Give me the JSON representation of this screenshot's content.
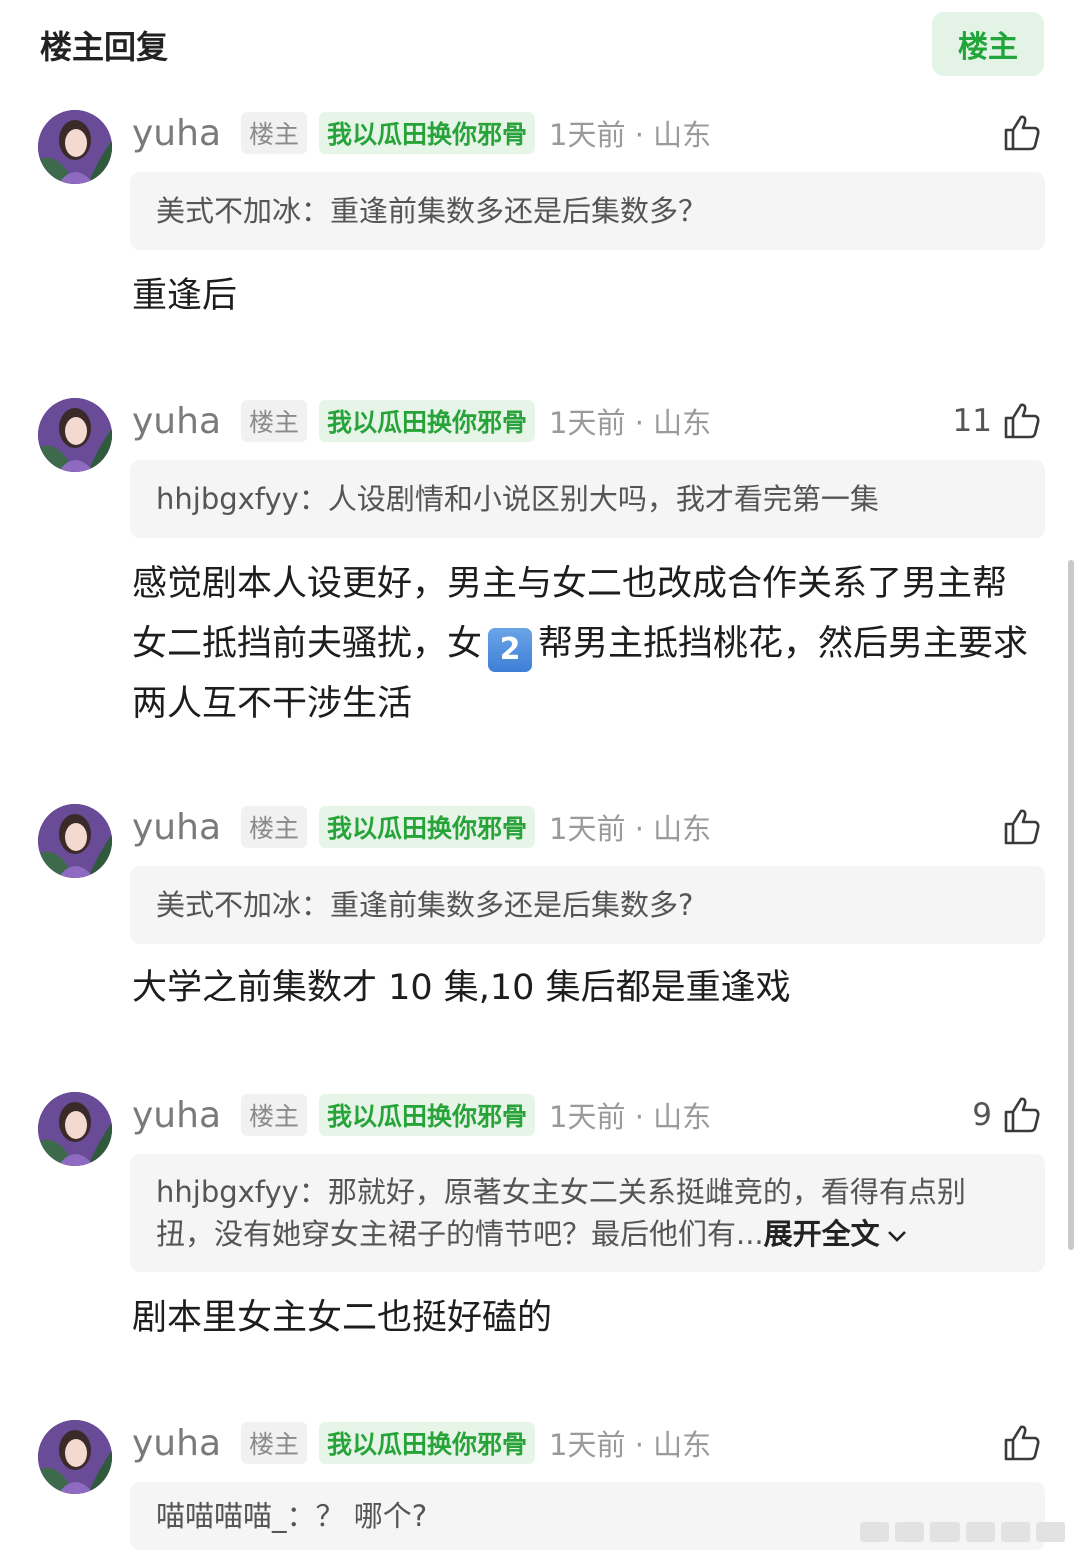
{
  "header": {
    "title": "楼主回复",
    "filter_button": "楼主"
  },
  "comments": [
    {
      "username": "yuha",
      "op_tag": "楼主",
      "fan_tag": "我以瓜田换你邪骨",
      "meta": "1天前 · 山东",
      "likes": "",
      "quote_author": "美式不加冰：",
      "quote_text": "重逢前集数多还是后集数多？",
      "reply": "重逢后"
    },
    {
      "username": "yuha",
      "op_tag": "楼主",
      "fan_tag": "我以瓜田换你邪骨",
      "meta": "1天前 · 山东",
      "likes": "11",
      "quote_author": "hhjbgxfyy：",
      "quote_text": "人设剧情和小说区别大吗，我才看完第一集",
      "reply_part1": "感觉剧本人设更好，男主与女二也改成合作关系了男主帮女二抵挡前夫骚扰，女",
      "reply_badge": "2",
      "reply_part2": "帮男主抵挡桃花，然后男主要求两人互不干涉生活"
    },
    {
      "username": "yuha",
      "op_tag": "楼主",
      "fan_tag": "我以瓜田换你邪骨",
      "meta": "1天前 · 山东",
      "likes": "",
      "quote_author": "美式不加冰：",
      "quote_text": "重逢前集数多还是后集数多?",
      "reply": "大学之前集数才 10 集,10 集后都是重逢戏"
    },
    {
      "username": "yuha",
      "op_tag": "楼主",
      "fan_tag": "我以瓜田换你邪骨",
      "meta": "1天前 · 山东",
      "likes": "9",
      "quote_author": "hhjbgxfyy：",
      "quote_text": "那就好，原著女主女二关系挺雌竞的，看得有点别扭，没有她穿女主裙子的情节吧？最后他们有...",
      "expand_label": "展开全文",
      "reply": "剧本里女主女二也挺好磕的"
    },
    {
      "username": "yuha",
      "op_tag": "楼主",
      "fan_tag": "我以瓜田换你邪骨",
      "meta": "1天前 · 山东",
      "likes": "",
      "quote_author": "喵喵喵喵_：",
      "quote_text": "？ 哪个?",
      "reply": ""
    }
  ],
  "colors": {
    "accent_green": "#22a63c",
    "quote_bg": "#f5f5f5",
    "text_main": "#1d1d1d",
    "text_meta": "#9a9a9a"
  },
  "icons": {
    "like": "thumbs-up-icon",
    "expand": "chevron-down-icon",
    "avatar": "user-avatar"
  }
}
